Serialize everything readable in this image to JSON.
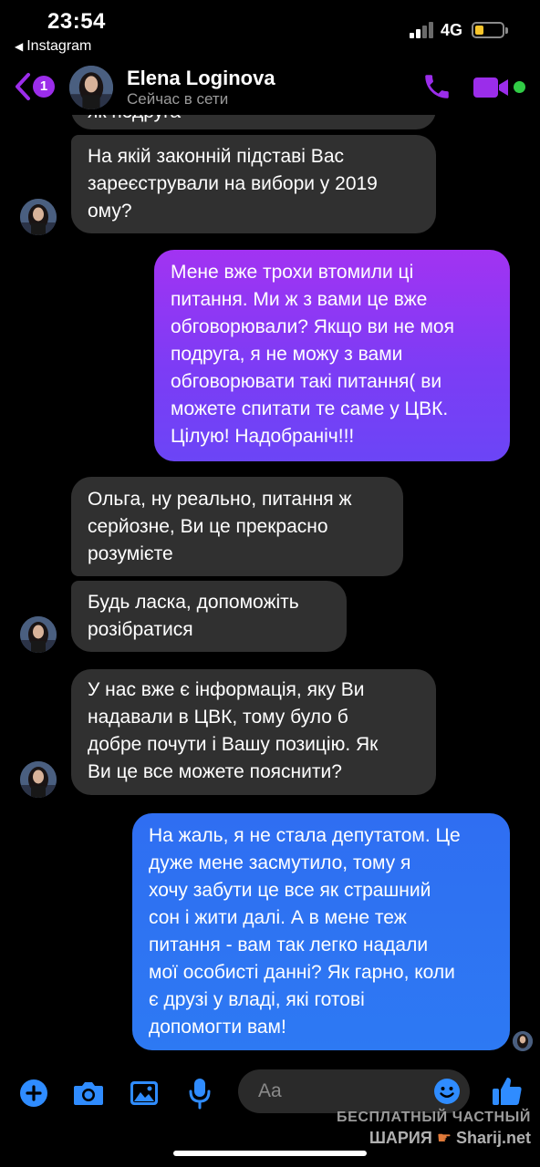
{
  "status_bar": {
    "time": "23:54",
    "back_app": "Instagram",
    "network": "4G",
    "battery_level": 0.2
  },
  "header": {
    "unread_count": "1",
    "contact_name": "Elena Loginova",
    "presence": "Сейчас в сети",
    "accent_color": "#9b2dea",
    "online_color": "#31cc46"
  },
  "messages": [
    {
      "from": "contact",
      "lines": [
        "як подруга"
      ]
    },
    {
      "from": "contact",
      "lines": [
        "На якій законній підставі Вас",
        "зареєстрували на вибори у 2019",
        "ому?"
      ]
    },
    {
      "from": "me",
      "lines": [
        "Мене вже трохи втомили ці",
        "питання. Ми ж з вами це вже",
        "обговорювали? Якщо ви не моя",
        "подруга, я не можу з вами",
        "обговорювати такі питання( ви",
        "можете спитати те саме у ЦВК.",
        "Цілую! Надобраніч!!!"
      ]
    },
    {
      "from": "contact",
      "lines": [
        "Ольга, ну реально, питання ж",
        "серйозне, Ви це прекрасно",
        "розумієте"
      ]
    },
    {
      "from": "contact",
      "lines": [
        "Будь ласка, допоможіть",
        "розібратися"
      ]
    },
    {
      "from": "contact",
      "lines": [
        "У нас вже є інформація, яку Ви",
        "надавали в ЦВК, тому було б",
        "добре почути і Вашу позицію. Як",
        "Ви це все можете пояснити?"
      ]
    },
    {
      "from": "me",
      "lines": [
        "На жаль, я не стала депутатом. Це",
        "дуже мене засмутило, тому я",
        "хочу забути це все як страшний",
        "сон і жити далі. А в мене теж",
        "питання - вам так легко надали",
        "мої особисті данні? Як гарно, коли",
        "є друзі у владі, які готові",
        "допомогти вам!"
      ]
    }
  ],
  "composer": {
    "placeholder": "Aa",
    "icons": [
      "plus-icon",
      "camera-icon",
      "gallery-icon",
      "mic-icon",
      "emoji-icon",
      "like-icon"
    ],
    "accent_color": "#2f8cff"
  },
  "watermark": {
    "line1": "БЕСПЛАТНЫЙ ЧАСТНЫЙ",
    "line2_left": "ШАРИЯ",
    "line2_right": "Sharij.net"
  }
}
